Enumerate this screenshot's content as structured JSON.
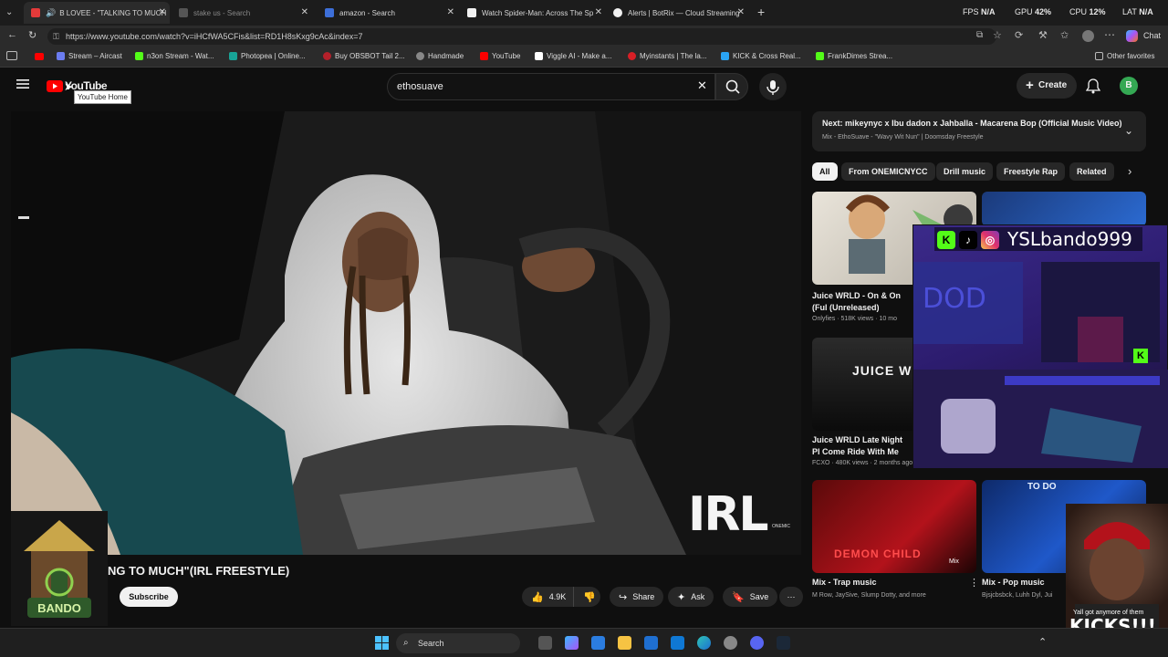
{
  "browser": {
    "tabs": [
      {
        "title": "B LOVEE - \"TALKING TO MUCH",
        "active": true,
        "favicon_color": "#e33a3a"
      },
      {
        "title": "stake us - Search",
        "active": false,
        "favicon_color": "#555555"
      },
      {
        "title": "amazon - Search",
        "active": false,
        "favicon_color": "#3d6fd9"
      },
      {
        "title": "Watch Spider-Man: Across The Sp",
        "active": false,
        "favicon_color": "#f1f1f1"
      },
      {
        "title": "Alerts | BotRix — Cloud Streaming",
        "active": false,
        "favicon_color": "#f1f1f1"
      }
    ],
    "new_tab": "+",
    "stats": {
      "fps_label": "FPS",
      "fps_value": "N/A",
      "gpu_label": "GPU",
      "gpu_value": "42",
      "cpu_label": "CPU",
      "cpu_value": "12",
      "lat_label": "LAT",
      "lat_value": "N/A"
    },
    "url": "https://www.youtube.com/watch?v=iHCfWA5CFis&list=RD1H8sKxg9cAc&index=7",
    "chat_label": "Chat",
    "bookmarks": [
      {
        "label": "Stream – Aircast",
        "color": "#6b7cf0"
      },
      {
        "label": "n3on Stream - Wat...",
        "color": "#53fc18"
      },
      {
        "label": "Photopea | Online...",
        "color": "#18a497"
      },
      {
        "label": "Buy OBSBOT Tail 2...",
        "color": "#b3202a"
      },
      {
        "label": "Handmade",
        "color": "#888888"
      },
      {
        "label": "YouTube",
        "color": "#ff0000"
      },
      {
        "label": "Viggle AI - Make a...",
        "color": "#ffffff"
      },
      {
        "label": "Myinstants | The la...",
        "color": "#d81f26"
      },
      {
        "label": "KICK & Cross Real...",
        "color": "#2aa4f4"
      },
      {
        "label": "FrankDimes Strea...",
        "color": "#53fc18"
      }
    ],
    "other_favorites": "Other favorites"
  },
  "youtube": {
    "logo_text": "YouTube",
    "tooltip": "YouTube Home",
    "search_value": "ethosuave",
    "create_label": "Create",
    "avatar_letter": "B",
    "video_watermark": "IRL",
    "video_watermark_small": "ONEMIC",
    "video_title": "NG TO MUCH\"(IRL FREESTYLE)",
    "subscribe_label": "Subscribe",
    "like_count": "4.9K",
    "share_label": "Share",
    "ask_label": "Ask",
    "save_label": "Save",
    "up_next": {
      "next_prefix": "Next:",
      "next_title": "mikeynyc x Ibu dadon x Jahballa - Macarena Bop (Official Music Video)",
      "mix_line": "Mix - EthoSuave - \"Wavy Wit Nun\" | Doomsday Freestyle"
    },
    "chips": [
      "All",
      "From ONEMICNYCC",
      "Drill music",
      "Freestyle Rap",
      "Related"
    ],
    "related": [
      {
        "title": "Juice WRLD - On & On (Ful (Unreleased)",
        "meta": "Onlyfies · 518K views · 10 mo"
      },
      {
        "title": "Juice WRLD Late Night Pl Come Ride With Me",
        "meta": "FCXO · 480K views · 2 months ago"
      },
      {
        "title": "Mix - Trap music",
        "meta": "M Row, JaySive, Slump Dotty, and more"
      },
      {
        "title": "Mix - Pop music",
        "meta": "Bjsjcbsbck, Luhh Dyl, Jui"
      }
    ],
    "thumb_texts": {
      "juice": "JUICE W",
      "demon": "DEMON CHILD",
      "mix_badge": "Mix",
      "todo": "TO DO"
    }
  },
  "overlays": {
    "stream_name": "YSLbando999",
    "caption_line1": "Yall got anymore of them",
    "caption_line2": "KICKS!!!",
    "logo_text": "YSL BANDO"
  },
  "taskbar": {
    "search_placeholder": "Search"
  }
}
